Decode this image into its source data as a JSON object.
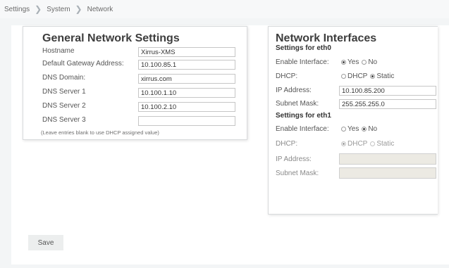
{
  "breadcrumb": {
    "items": [
      "Settings",
      "System",
      "Network"
    ]
  },
  "general": {
    "title": "General Network Settings",
    "fields": {
      "hostname": {
        "label": "Hostname",
        "value": "Xirrus-XMS"
      },
      "gateway": {
        "label": "Default Gateway Address:",
        "value": "10.100.85.1"
      },
      "dns_domain": {
        "label": "DNS Domain:",
        "value": "xirrus.com"
      },
      "dns1": {
        "label": "DNS Server 1",
        "value": "10.100.1.10"
      },
      "dns2": {
        "label": "DNS Server 2",
        "value": "10.100.2.10"
      },
      "dns3": {
        "label": "DNS Server 3",
        "value": ""
      }
    },
    "note": "(Leave entries blank to use DHCP assigned value)"
  },
  "interfaces": {
    "title": "Network Interfaces",
    "eth0": {
      "title": "Settings for eth0",
      "enable_label": "Enable Interface:",
      "enable_options": [
        "Yes",
        "No"
      ],
      "enable_selected": "Yes",
      "dhcp_label": "DHCP:",
      "dhcp_options": [
        "DHCP",
        "Static"
      ],
      "dhcp_selected": "Static",
      "ip_label": "IP Address:",
      "ip_value": "10.100.85.200",
      "mask_label": "Subnet Mask:",
      "mask_value": "255.255.255.0"
    },
    "eth1": {
      "title": "Settings for eth1",
      "enable_label": "Enable Interface:",
      "enable_options": [
        "Yes",
        "No"
      ],
      "enable_selected": "No",
      "dhcp_label": "DHCP:",
      "dhcp_options": [
        "DHCP",
        "Static"
      ],
      "dhcp_selected": "DHCP",
      "ip_label": "IP Address:",
      "ip_value": "",
      "mask_label": "Subnet Mask:",
      "mask_value": ""
    }
  },
  "actions": {
    "save_label": "Save"
  },
  "colors": {
    "page_bg": "#f3f5f6",
    "panel_border": "#d8dadc",
    "disabled_field": "#eceae3"
  }
}
